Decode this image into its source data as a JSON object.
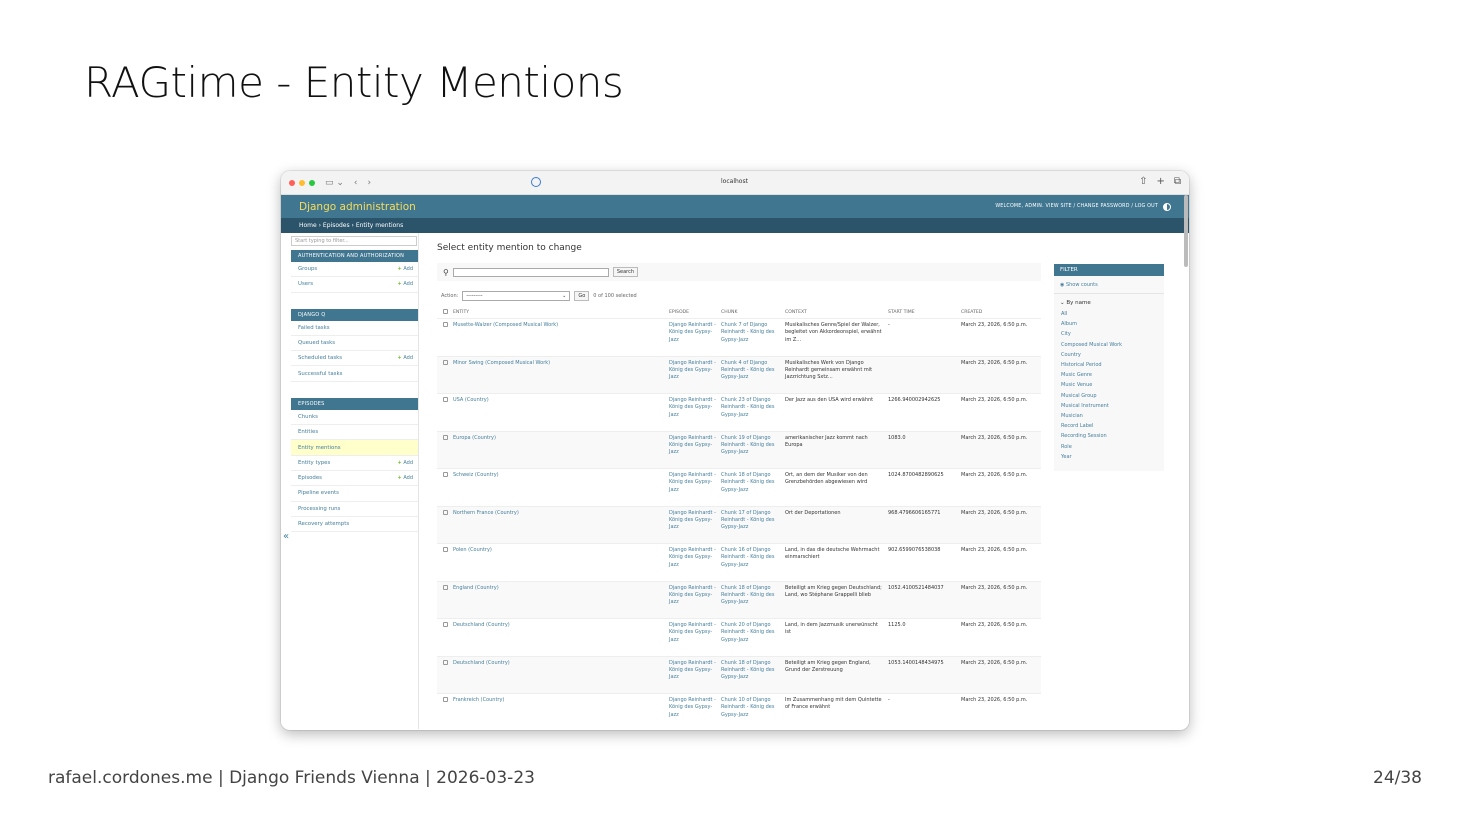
{
  "slide": {
    "title": "RAGtime - Entity Mentions",
    "footer": "rafael.cordones.me | Django Friends Vienna | 2026-03-23",
    "page": "24/38"
  },
  "browser": {
    "url": "localhost",
    "colors": {
      "close": "#ff5f57",
      "minimize": "#febc2e",
      "zoom": "#28c840"
    }
  },
  "admin": {
    "brand": "Django administration",
    "user_tools": "WELCOME, ADMIN. VIEW SITE / CHANGE PASSWORD / LOG OUT",
    "breadcrumbs": "Home › Episodes › Entity mentions",
    "nav_filter_placeholder": "Start typing to filter...",
    "colors": {
      "header": "#417690",
      "brand": "#f5dd5d",
      "breadcrumbs": "#2b546b",
      "link": "#447e9b",
      "active_row": "#ffffcc",
      "add": "#70bf2b"
    },
    "modules": [
      {
        "caption": "AUTHENTICATION AND AUTHORIZATION",
        "items": [
          {
            "label": "Groups",
            "add": "Add"
          },
          {
            "label": "Users",
            "add": "Add"
          }
        ]
      },
      {
        "caption": "DJANGO Q",
        "items": [
          {
            "label": "Failed tasks",
            "add": ""
          },
          {
            "label": "Queued tasks",
            "add": ""
          },
          {
            "label": "Scheduled tasks",
            "add": "Add"
          },
          {
            "label": "Successful tasks",
            "add": ""
          }
        ]
      },
      {
        "caption": "EPISODES",
        "items": [
          {
            "label": "Chunks",
            "add": ""
          },
          {
            "label": "Entities",
            "add": ""
          },
          {
            "label": "Entity mentions",
            "add": "",
            "active": true
          },
          {
            "label": "Entity types",
            "add": "Add"
          },
          {
            "label": "Episodes",
            "add": "Add"
          },
          {
            "label": "Pipeline events",
            "add": ""
          },
          {
            "label": "Processing runs",
            "add": ""
          },
          {
            "label": "Recovery attempts",
            "add": ""
          }
        ]
      }
    ]
  },
  "changelist": {
    "heading": "Select entity mention to change",
    "search_button": "Search",
    "action_label": "Action:",
    "action_value": "---------",
    "go_button": "Go",
    "selected_text": "0 of 100 selected",
    "columns": [
      "ENTITY",
      "EPISODE",
      "CHUNK",
      "CONTEXT",
      "START TIME",
      "CREATED"
    ],
    "rows": [
      {
        "entity": "Musette-Walzer (Composed Musical Work)",
        "episode": "Django Reinhardt - König des Gypsy-Jazz",
        "chunk": "Chunk 7 of Django Reinhardt - König des Gypsy-Jazz",
        "context": "Musikalisches Genre/Spiel der Walzer, begleitet von Akkordeonspiel, erwähnt im Z...",
        "start": "-",
        "created": "March 23, 2026, 6:50 p.m."
      },
      {
        "entity": "Minor Swing (Composed Musical Work)",
        "episode": "Django Reinhardt - König des Gypsy-Jazz",
        "chunk": "Chunk 4 of Django Reinhardt - König des Gypsy-Jazz",
        "context": "Musikalisches Werk von Django Reinhardt gemeinsam erwähnt mit Jazzrichtung Sxtz...",
        "start": "",
        "created": "March 23, 2026, 6:50 p.m."
      },
      {
        "entity": "USA (Country)",
        "episode": "Django Reinhardt - König des Gypsy-Jazz",
        "chunk": "Chunk 23 of Django Reinhardt - König des Gypsy-Jazz",
        "context": "Der Jazz aus den USA wird erwähnt",
        "start": "1266.940002942625",
        "created": "March 23, 2026, 6:50 p.m."
      },
      {
        "entity": "Europa (Country)",
        "episode": "Django Reinhardt - König des Gypsy-Jazz",
        "chunk": "Chunk 19 of Django Reinhardt - König des Gypsy-Jazz",
        "context": "amerikanischer Jazz kommt nach Europa",
        "start": "1083.0",
        "created": "March 23, 2026, 6:50 p.m."
      },
      {
        "entity": "Schweiz (Country)",
        "episode": "Django Reinhardt - König des Gypsy-Jazz",
        "chunk": "Chunk 18 of Django Reinhardt - König des Gypsy-Jazz",
        "context": "Ort, an dem der Musiker von den Grenzbehörden abgewiesen wird",
        "start": "1024.8700482890625",
        "created": "March 23, 2026, 6:50 p.m."
      },
      {
        "entity": "Northern France (Country)",
        "episode": "Django Reinhardt - König des Gypsy-Jazz",
        "chunk": "Chunk 17 of Django Reinhardt - König des Gypsy-Jazz",
        "context": "Ort der Deportationen",
        "start": "968.4796606165771",
        "created": "March 23, 2026, 6:50 p.m."
      },
      {
        "entity": "Polen (Country)",
        "episode": "Django Reinhardt - König des Gypsy-Jazz",
        "chunk": "Chunk 16 of Django Reinhardt - König des Gypsy-Jazz",
        "context": "Land, in das die deutsche Wehrmacht einmarschiert",
        "start": "902.6599076538038",
        "created": "March 23, 2026, 6:50 p.m."
      },
      {
        "entity": "England (Country)",
        "episode": "Django Reinhardt - König des Gypsy-Jazz",
        "chunk": "Chunk 18 of Django Reinhardt - König des Gypsy-Jazz",
        "context": "Beteiligt am Krieg gegen Deutschland; Land, wo Stéphane Grappelli blieb",
        "start": "1052.4100521484037",
        "created": "March 23, 2026, 6:50 p.m."
      },
      {
        "entity": "Deutschland (Country)",
        "episode": "Django Reinhardt - König des Gypsy-Jazz",
        "chunk": "Chunk 20 of Django Reinhardt - König des Gypsy-Jazz",
        "context": "Land, in dem Jazzmusik unerwünscht ist",
        "start": "1125.0",
        "created": "March 23, 2026, 6:50 p.m."
      },
      {
        "entity": "Deutschland (Country)",
        "episode": "Django Reinhardt - König des Gypsy-Jazz",
        "chunk": "Chunk 18 of Django Reinhardt - König des Gypsy-Jazz",
        "context": "Beteiligt am Krieg gegen England, Grund der Zerstreuung",
        "start": "1053.1400148434975",
        "created": "March 23, 2026, 6:50 p.m."
      },
      {
        "entity": "Frankreich (Country)",
        "episode": "Django Reinhardt - König des Gypsy-Jazz",
        "chunk": "Chunk 10 of Django Reinhardt - König des Gypsy-Jazz",
        "context": "Im Zusammenhang mit dem Quintette of France erwähnt",
        "start": "-",
        "created": "March 23, 2026, 6:50 p.m."
      }
    ]
  },
  "filter": {
    "caption": "FILTER",
    "show_counts": "Show counts",
    "by_name": "By name",
    "options": [
      "All",
      "Album",
      "City",
      "Composed Musical Work",
      "Country",
      "Historical Period",
      "Music Genre",
      "Music Venue",
      "Musical Group",
      "Musical Instrument",
      "Musician",
      "Record Label",
      "Recording Session",
      "Role",
      "Year"
    ]
  }
}
